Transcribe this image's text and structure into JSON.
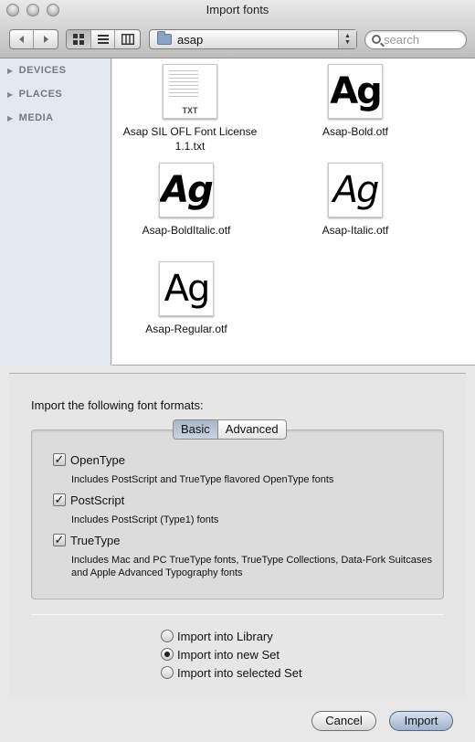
{
  "window": {
    "title": "Import fonts"
  },
  "toolbar": {
    "back_icon": "back-icon",
    "forward_icon": "forward-icon",
    "view_icons": [
      "icon-view-icon",
      "list-view-icon",
      "column-view-icon"
    ],
    "folder": "asap",
    "search_placeholder": "search"
  },
  "sidebar": {
    "items": [
      {
        "label": "DEVICES"
      },
      {
        "label": "PLACES"
      },
      {
        "label": "MEDIA"
      }
    ]
  },
  "files": [
    {
      "name_line1": "Asap SIL OFL Font License",
      "name_line2": "1.1.txt",
      "kind": "txt",
      "badge": "TXT"
    },
    {
      "name": "Asap-Bold.otf",
      "glyph": "Ag",
      "style": "bold"
    },
    {
      "name": "Asap-BoldItalic.otf",
      "glyph": "Ag",
      "style": "bold-italic"
    },
    {
      "name": "Asap-Italic.otf",
      "glyph": "Ag",
      "style": "italic"
    },
    {
      "name": "Asap-Regular.otf",
      "glyph": "Ag",
      "style": "regular"
    }
  ],
  "formats": {
    "heading": "Import the following font formats:",
    "tabs": [
      "Basic",
      "Advanced"
    ],
    "selected_tab": "Basic",
    "options": [
      {
        "label": "OpenType",
        "checked": true,
        "description": "Includes PostScript and TrueType flavored OpenType fonts"
      },
      {
        "label": "PostScript",
        "checked": true,
        "description": "Includes PostScript (Type1) fonts"
      },
      {
        "label": "TrueType",
        "checked": true,
        "description": "Includes Mac and PC TrueType fonts, TrueType Collections, Data-Fork Suitcases and Apple Advanced Typography fonts"
      }
    ]
  },
  "destination": {
    "options": [
      "Import into Library",
      "Import into new Set",
      "Import into selected Set"
    ],
    "selected": "Import into new Set"
  },
  "buttons": {
    "cancel": "Cancel",
    "import": "Import"
  }
}
